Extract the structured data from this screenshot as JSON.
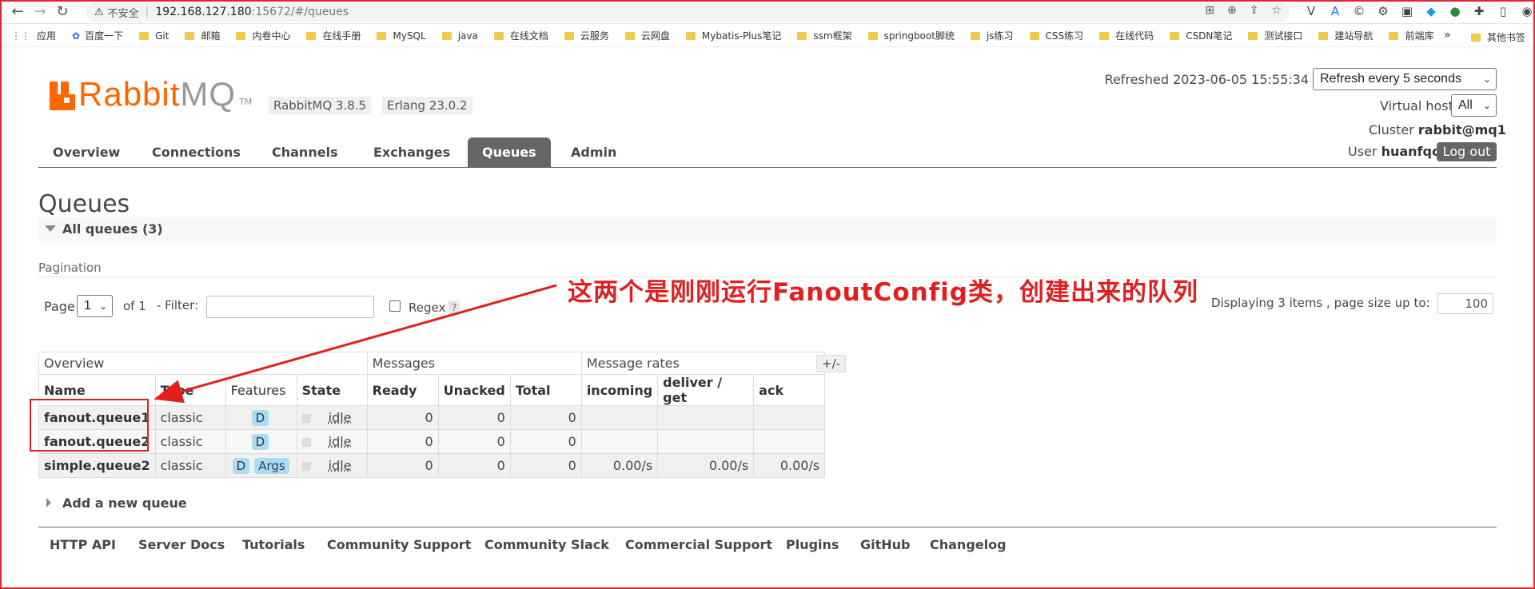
{
  "browser": {
    "security_warning": "不安全",
    "url_host": "192.168.127.180",
    "url_path": ":15672/#/queues",
    "bookmarks": [
      "应用",
      "百度一下",
      "Git",
      "邮箱",
      "内卷中心",
      "在线手册",
      "MySQL",
      "java",
      "在线文档",
      "云服务",
      "云网盘",
      "Mybatis-Plus笔记",
      "ssm框架",
      "springboot脚统",
      "js练习",
      "CSS练习",
      "在线代码",
      "CSDN笔记",
      "测试接口",
      "建站导航",
      "前端库"
    ],
    "bookmarks_more": "»",
    "other_bookmarks": "其他书签"
  },
  "header": {
    "logo_rabbit": "Rabbit",
    "logo_mq": "MQ",
    "logo_tm": "TM",
    "rabbitmq_version": "RabbitMQ 3.8.5",
    "erlang_version": "Erlang 23.0.2",
    "refreshed": "Refreshed 2023-06-05 15:55:34",
    "refresh_select": "Refresh every 5 seconds",
    "vhost_label": "Virtual host",
    "vhost_value": "All",
    "cluster_label": "Cluster",
    "cluster_value": "rabbit@mq1",
    "user_label": "User",
    "user_value": "huanfqc",
    "logout": "Log out"
  },
  "tabs": [
    "Overview",
    "Connections",
    "Channels",
    "Exchanges",
    "Queues",
    "Admin"
  ],
  "active_tab": "Queues",
  "page": {
    "title": "Queues",
    "all_queues": "All queues (3)",
    "pagination_label": "Pagination",
    "page_label": "Page",
    "page_value": "1",
    "of_text": "of 1",
    "filter_label": "- Filter:",
    "regex_label": "Regex",
    "regex_help": "?",
    "displaying": "Displaying 3 items , page size up to:",
    "page_size": "100",
    "add_queue": "Add a new queue"
  },
  "annotation": "这两个是刚刚运行FanoutConfig类，创建出来的队列",
  "table": {
    "groups": [
      "Overview",
      "Messages",
      "Message rates"
    ],
    "toggle": "+/-",
    "columns": [
      "Name",
      "Type",
      "Features",
      "State",
      "Ready",
      "Unacked",
      "Total",
      "incoming",
      "deliver / get",
      "ack"
    ],
    "rows": [
      {
        "name": "fanout.queue1",
        "type": "classic",
        "features": [
          "D"
        ],
        "state": "idle",
        "ready": "0",
        "unacked": "0",
        "total": "0",
        "incoming": "",
        "deliver": "",
        "ack": ""
      },
      {
        "name": "fanout.queue2",
        "type": "classic",
        "features": [
          "D"
        ],
        "state": "idle",
        "ready": "0",
        "unacked": "0",
        "total": "0",
        "incoming": "",
        "deliver": "",
        "ack": ""
      },
      {
        "name": "simple.queue2",
        "type": "classic",
        "features": [
          "D",
          "Args"
        ],
        "state": "idle",
        "ready": "0",
        "unacked": "0",
        "total": "0",
        "incoming": "0.00/s",
        "deliver": "0.00/s",
        "ack": "0.00/s"
      }
    ]
  },
  "footer_links": [
    "HTTP API",
    "Server Docs",
    "Tutorials",
    "Community Support",
    "Community Slack",
    "Commercial Support",
    "Plugins",
    "GitHub",
    "Changelog"
  ],
  "colors": {
    "brand": "#ff6600",
    "annotation": "#e21f1f",
    "tab_active": "#666666",
    "badge": "#aaddee"
  }
}
